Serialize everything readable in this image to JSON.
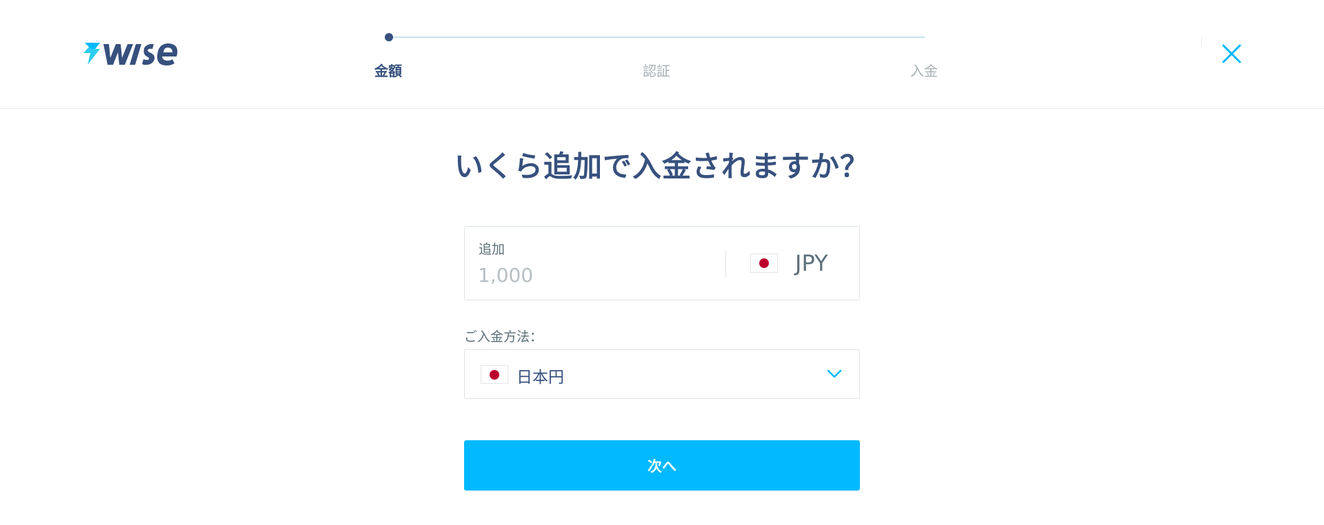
{
  "brand": {
    "name": "wise",
    "accent_color": "#00b9ff",
    "dark_color": "#37517e",
    "logo_icon": "wise-flag-logo-icon"
  },
  "stepper": {
    "steps": [
      {
        "label": "金額",
        "state": "active"
      },
      {
        "label": "認証",
        "state": "upcoming"
      },
      {
        "label": "入金",
        "state": "upcoming"
      }
    ]
  },
  "header": {
    "close_icon": "close-icon"
  },
  "main": {
    "title": "いくら追加で入金されますか？",
    "amount": {
      "label": "追加",
      "value": "",
      "placeholder": "1,000",
      "currency": {
        "code": "JPY",
        "flag": "japan-flag-icon"
      }
    },
    "payment_method": {
      "label": "ご入金方法：",
      "selected": "日本円",
      "flag": "japan-flag-icon",
      "dropdown_icon": "chevron-down-icon"
    },
    "next_button_label": "次へ"
  }
}
